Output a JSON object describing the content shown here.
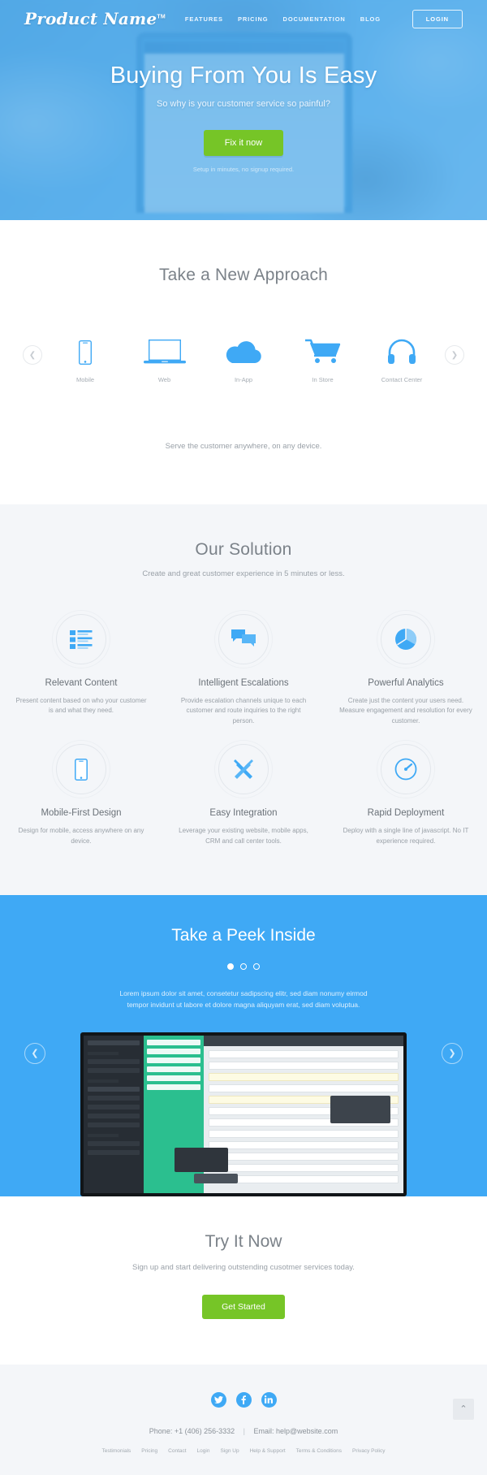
{
  "nav": {
    "brand": "Product Name",
    "brand_tm": "TM",
    "links": [
      {
        "label": "FEATURES"
      },
      {
        "label": "PRICING"
      },
      {
        "label": "DOCUMENTATION"
      },
      {
        "label": "BLOG"
      }
    ],
    "login_label": "LOGIN"
  },
  "hero": {
    "title": "Buying From You Is Easy",
    "subtitle": "So why is your customer service so painful?",
    "cta_label": "Fix it now",
    "note": "Setup in minutes, no signup required.",
    "accent_green": "#76c527",
    "accent_blue": "#3fa9f5"
  },
  "approach": {
    "title": "Take a New Approach",
    "prev_icon": "chevron-left-icon",
    "next_icon": "chevron-right-icon",
    "items": [
      {
        "label": "Mobile",
        "icon": "mobile-phone-icon"
      },
      {
        "label": "Web",
        "icon": "laptop-icon"
      },
      {
        "label": "In-App",
        "icon": "cloud-icon"
      },
      {
        "label": "In Store",
        "icon": "shopping-cart-icon"
      },
      {
        "label": "Contact Center",
        "icon": "headset-icon"
      }
    ],
    "footer_text": "Serve the customer anywhere, on any device."
  },
  "solution": {
    "title": "Our Solution",
    "subtitle": "Create and great customer experience in 5 minutes or less.",
    "features": [
      {
        "icon": "list-content-icon",
        "title": "Relevant Content",
        "desc": "Present content based on who your customer is and what they need."
      },
      {
        "icon": "chat-bubbles-icon",
        "title": "Intelligent Escalations",
        "desc": "Provide escalation channels unique to each customer and route inquiries to the right person."
      },
      {
        "icon": "pie-chart-icon",
        "title": "Powerful Analytics",
        "desc": "Create just the content your users need. Measure engagement and resolution for every customer."
      },
      {
        "icon": "mobile-phone-icon",
        "title": "Mobile-First Design",
        "desc": "Design for mobile, access anywhere on any device."
      },
      {
        "icon": "tools-icon",
        "title": "Easy Integration",
        "desc": "Leverage your existing website, mobile apps, CRM and call center tools."
      },
      {
        "icon": "speedometer-icon",
        "title": "Rapid Deployment",
        "desc": "Deploy with a single line of javascript. No IT experience required."
      }
    ]
  },
  "peek": {
    "title": "Take a Peek Inside",
    "dots": [
      {
        "active": true
      },
      {
        "active": false
      },
      {
        "active": false
      }
    ],
    "text": "Lorem ipsum dolor sit amet, consetetur sadipscing elitr, sed diam nonumy eirmod tempor invidunt ut labore et dolore magna aliquyam erat, sed diam voluptua.",
    "prev_icon": "chevron-left-icon",
    "next_icon": "chevron-right-icon",
    "screenshot_alt": "product-dashboard-screenshot"
  },
  "tryit": {
    "title": "Try It Now",
    "subtitle": "Sign up and start delivering outstending cusotmer services today.",
    "cta_label": "Get Started"
  },
  "footer": {
    "socials": [
      {
        "name": "twitter-icon",
        "glyph": "✈"
      },
      {
        "name": "facebook-icon",
        "glyph": "f"
      },
      {
        "name": "linkedin-icon",
        "glyph": "in"
      }
    ],
    "phone": "Phone: +1 (406) 256-3332",
    "separator": "|",
    "email": "Email: help@website.com",
    "links": [
      {
        "label": "Testimonials"
      },
      {
        "label": "Pricing"
      },
      {
        "label": "Contact"
      },
      {
        "label": "Login"
      },
      {
        "label": "Sign Up"
      },
      {
        "label": "Help & Support"
      },
      {
        "label": "Terms & Conditions"
      },
      {
        "label": "Privacy Policy"
      }
    ],
    "to_top_icon": "chevron-up-icon",
    "to_top_glyph": "⌃"
  }
}
